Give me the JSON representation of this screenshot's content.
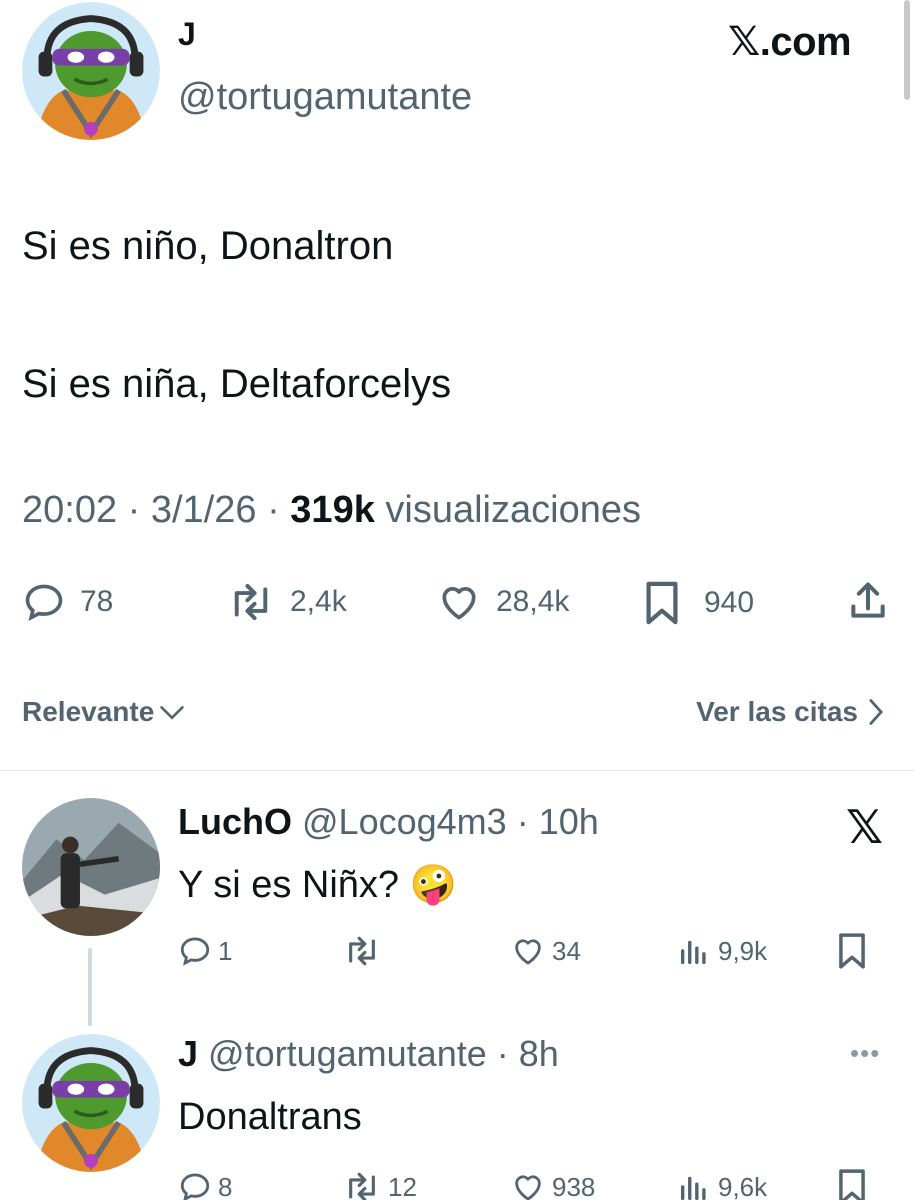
{
  "main_tweet": {
    "author_name": "J",
    "handle": "@tortugamutante",
    "brand": "𝕏.com",
    "text_lines": [
      "Si es niño, Donaltron",
      "Si es niña, Deltaforcelys"
    ],
    "time": "20:02 · 3/1/26 · ",
    "views": "319k",
    "views_label": " visualizaciones",
    "actions": {
      "replies": "78",
      "reposts": "2,4k",
      "likes": "28,4k",
      "bookmarks": "940"
    }
  },
  "sort": {
    "left_label": "Relevante",
    "right_label": "Ver las citas"
  },
  "replies": [
    {
      "name": "LuchO",
      "handle": "@Locog4m3",
      "time": "10h",
      "text": "Y si es Niñx?",
      "emoji": "🤪",
      "actions": {
        "replies": "1",
        "reposts": "",
        "likes": "34",
        "views": "9,9k"
      }
    },
    {
      "name": "J",
      "handle": "@tortugamutante",
      "time": "8h",
      "text": "Donaltrans",
      "actions": {
        "replies": "8",
        "reposts": "12",
        "likes": "938",
        "views": "9,6k"
      }
    }
  ],
  "icons": {
    "reply": "reply-icon",
    "repost": "repost-icon",
    "like": "heart-icon",
    "bookmark": "bookmark-icon",
    "share": "share-icon",
    "views": "views-icon",
    "x": "x-logo-icon",
    "more": "more-icon"
  },
  "colors": {
    "text": "#0f1419",
    "secondary": "#536471",
    "divider": "#e1e5e8",
    "avatar_bg": "#c8e4f4"
  }
}
